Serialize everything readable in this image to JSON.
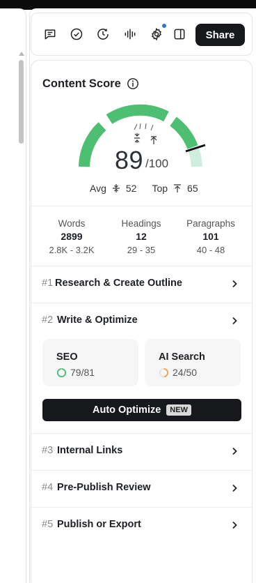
{
  "toolbar": {
    "icons": [
      "comment-icon",
      "check-circle-icon",
      "history-icon",
      "audio-wave-icon",
      "gear-icon",
      "sidebar-toggle-icon"
    ],
    "share_label": "Share",
    "notification_color": "#2f6fe4"
  },
  "content_score": {
    "title": "Content Score",
    "score": "89",
    "max": "/100",
    "avg_label": "Avg",
    "avg_value": "52",
    "top_label": "Top",
    "top_value": "65",
    "score_value": 89,
    "gauge_colors": {
      "filled": "#4dbf72",
      "remainder": "#cfeedd",
      "needle": "#111111"
    }
  },
  "stats": [
    {
      "label": "Words",
      "value": "2899",
      "range": "2.8K - 3.2K"
    },
    {
      "label": "Headings",
      "value": "12",
      "range": "29 - 35"
    },
    {
      "label": "Paragraphs",
      "value": "101",
      "range": "40 - 48"
    }
  ],
  "steps": [
    {
      "num": "#1",
      "label": "Research & Create Outline"
    },
    {
      "num": "#2",
      "label": "Write & Optimize"
    },
    {
      "num": "#3",
      "label": "Internal Links"
    },
    {
      "num": "#4",
      "label": "Pre-Publish Review"
    },
    {
      "num": "#5",
      "label": "Publish or Export"
    }
  ],
  "optimize": {
    "seo_title": "SEO",
    "seo_score": "79/81",
    "seo_fraction": 0.975,
    "seo_color": "#4dbf72",
    "ai_title": "AI Search",
    "ai_score": "24/50",
    "ai_fraction": 0.48,
    "ai_color": "#f0a25a",
    "auto_label": "Auto Optimize",
    "new_badge": "NEW"
  }
}
